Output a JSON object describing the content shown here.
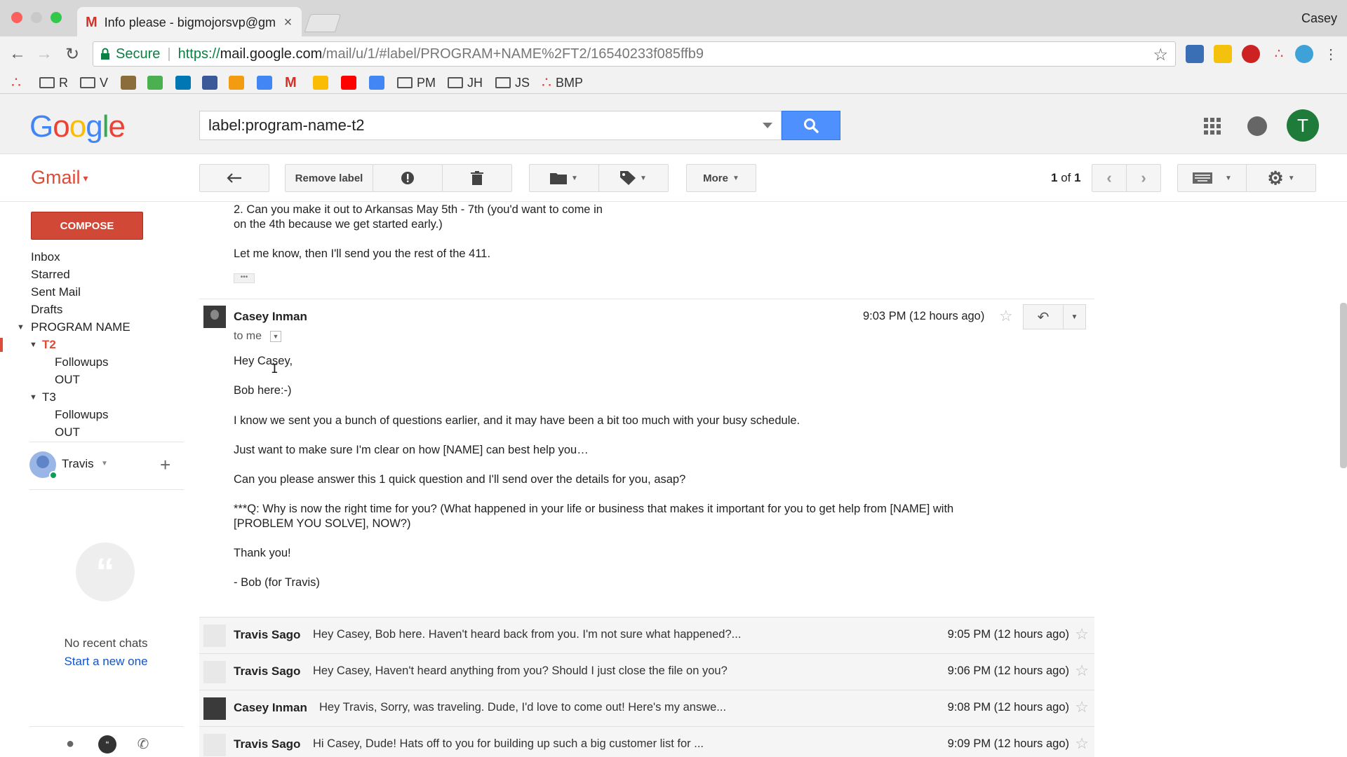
{
  "browser": {
    "tab_title": "Info please - bigmojorsvp@gm",
    "tab_close": "×",
    "profile_name": "Casey",
    "secure_label": "Secure",
    "url_scheme": "https://",
    "url_host": "mail.google.com",
    "url_path": "/mail/u/1/#label/PROGRAM+NAME%2FT2/16540233f085ffb9",
    "bookmarks": [
      "R",
      "V",
      "PM",
      "JH",
      "JS",
      "BMP"
    ]
  },
  "header": {
    "logo_letters": [
      "G",
      "o",
      "o",
      "g",
      "l",
      "e"
    ],
    "logo_colors": [
      "#4285f4",
      "#ea4335",
      "#fbbc05",
      "#4285f4",
      "#34a853",
      "#ea4335"
    ],
    "search_value": "label:program-name-t2",
    "user_initial": "T"
  },
  "toolbar": {
    "gmail_label": "Gmail",
    "remove_label": "Remove label",
    "more_label": "More",
    "pager_count": "1",
    "pager_of": "of",
    "pager_total": "1"
  },
  "sidebar": {
    "compose": "COMPOSE",
    "inbox": "Inbox",
    "starred": "Starred",
    "sent": "Sent Mail",
    "drafts": "Drafts",
    "program_name": "PROGRAM NAME",
    "t2": "T2",
    "t2_followups": "Followups",
    "t2_out": "OUT",
    "t3": "T3",
    "t3_followups": "Followups",
    "t3_out": "OUT",
    "chat_user": "Travis",
    "no_chats": "No recent chats",
    "start_chat": "Start a new one"
  },
  "thread": {
    "previous_tail": [
      "2. Can you make it out to Arkansas May 5th - 7th (you'd want to come in",
      "on the 4th because we get started early.)",
      "Let me know, then I'll send you the rest of the 411."
    ],
    "open_message": {
      "sender": "Casey Inman",
      "to": "to me",
      "time": "9:03 PM (12 hours ago)",
      "body": [
        "Hey Casey,",
        "Bob here:-)",
        "I know we sent you a bunch of questions earlier, and it may have been a bit too much with your busy schedule.",
        "Just want to make sure I'm clear on how [NAME] can best help you…",
        "Can you please answer this 1 quick question and I'll send over the details for you, asap?",
        "***Q: Why is now the right time for you? (What happened in your life or business that makes it important for you to get help from [NAME] with",
        "[PROBLEM YOU SOLVE], NOW?)",
        "Thank you!",
        "- Bob (for Travis)"
      ]
    },
    "collapsed": [
      {
        "sender": "Travis Sago",
        "snippet": "Hey Casey, Bob here. Haven't heard back from you. I'm not sure what happened?...",
        "time": "9:05 PM (12 hours ago)"
      },
      {
        "sender": "Travis Sago",
        "snippet": "Hey Casey, Haven't heard anything from you? Should I just close the file on you?",
        "time": "9:06 PM (12 hours ago)"
      },
      {
        "sender": "Casey Inman",
        "snippet": "Hey Travis, Sorry, was traveling. Dude, I'd love to come out! Here's my answe...",
        "time": "9:08 PM (12 hours ago)"
      },
      {
        "sender": "Travis Sago",
        "snippet": "Hi Casey, Dude! Hats off to you for building up such a big customer list for ...",
        "time": "9:09 PM (12 hours ago)"
      }
    ]
  }
}
